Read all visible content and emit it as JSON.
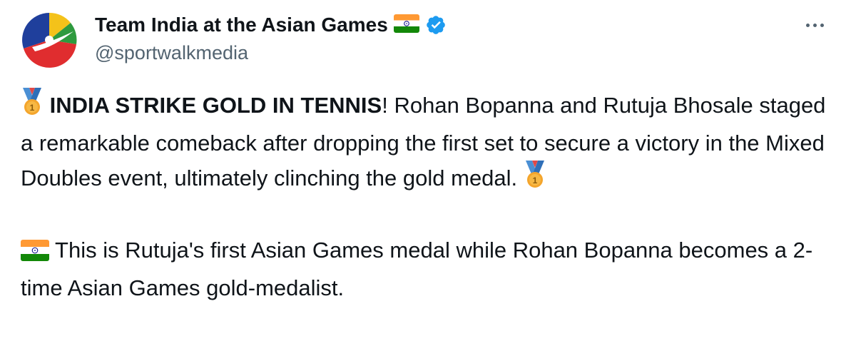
{
  "tweet": {
    "author": {
      "display_name": "Team India at the Asian Games",
      "handle": "@sportwalkmedia",
      "verified": true
    },
    "more_icon": "more-horizontal-icon",
    "text": {
      "headline": "INDIA STRIKE GOLD IN TENNIS",
      "exclamation": "!",
      "para1_rest": " Rohan Bopanna and Rutuja Bhosale staged a remarkable comeback after dropping the first set to secure a victory in the Mixed Doubles event, ultimately clinching the gold medal.",
      "para2": " This is Rutuja's first Asian Games medal while Rohan Bopanna becomes a 2-time Asian Games gold-medalist."
    },
    "emojis": {
      "medal": "first-place-medal",
      "flag": "india-flag"
    },
    "colors": {
      "text": "#0f1419",
      "secondary": "#536471",
      "verified": "#1d9bf0",
      "saffron": "#ff9933",
      "green": "#138808",
      "chakra": "#000080"
    }
  }
}
